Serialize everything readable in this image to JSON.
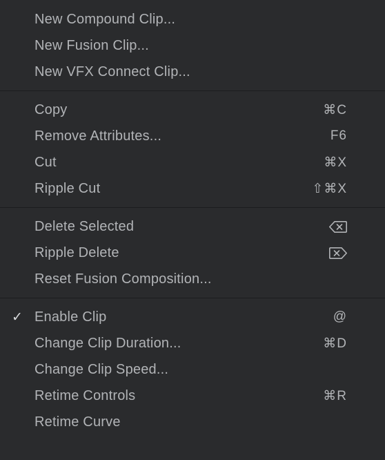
{
  "menu": {
    "groups": [
      {
        "items": [
          {
            "label": "New Compound Clip...",
            "shortcut": "",
            "checked": false
          },
          {
            "label": "New Fusion Clip...",
            "shortcut": "",
            "checked": false
          },
          {
            "label": "New VFX Connect Clip...",
            "shortcut": "",
            "checked": false
          }
        ]
      },
      {
        "items": [
          {
            "label": "Copy",
            "shortcut": "⌘C",
            "checked": false
          },
          {
            "label": "Remove Attributes...",
            "shortcut": "F6",
            "checked": false
          },
          {
            "label": "Cut",
            "shortcut": "⌘X",
            "checked": false
          },
          {
            "label": "Ripple Cut",
            "shortcut": "⇧⌘X",
            "checked": false
          }
        ]
      },
      {
        "items": [
          {
            "label": "Delete Selected",
            "shortcut": "ICON_DELETE_LEFT",
            "checked": false
          },
          {
            "label": "Ripple Delete",
            "shortcut": "ICON_DELETE_RIGHT",
            "checked": false
          },
          {
            "label": "Reset Fusion Composition...",
            "shortcut": "",
            "checked": false
          }
        ]
      },
      {
        "items": [
          {
            "label": "Enable Clip",
            "shortcut": "@",
            "checked": true
          },
          {
            "label": "Change Clip Duration...",
            "shortcut": "⌘D",
            "checked": false
          },
          {
            "label": "Change Clip Speed...",
            "shortcut": "",
            "checked": false
          },
          {
            "label": "Retime Controls",
            "shortcut": "⌘R",
            "checked": false
          },
          {
            "label": "Retime Curve",
            "shortcut": "",
            "checked": false
          }
        ]
      }
    ],
    "checkmark": "✓"
  }
}
